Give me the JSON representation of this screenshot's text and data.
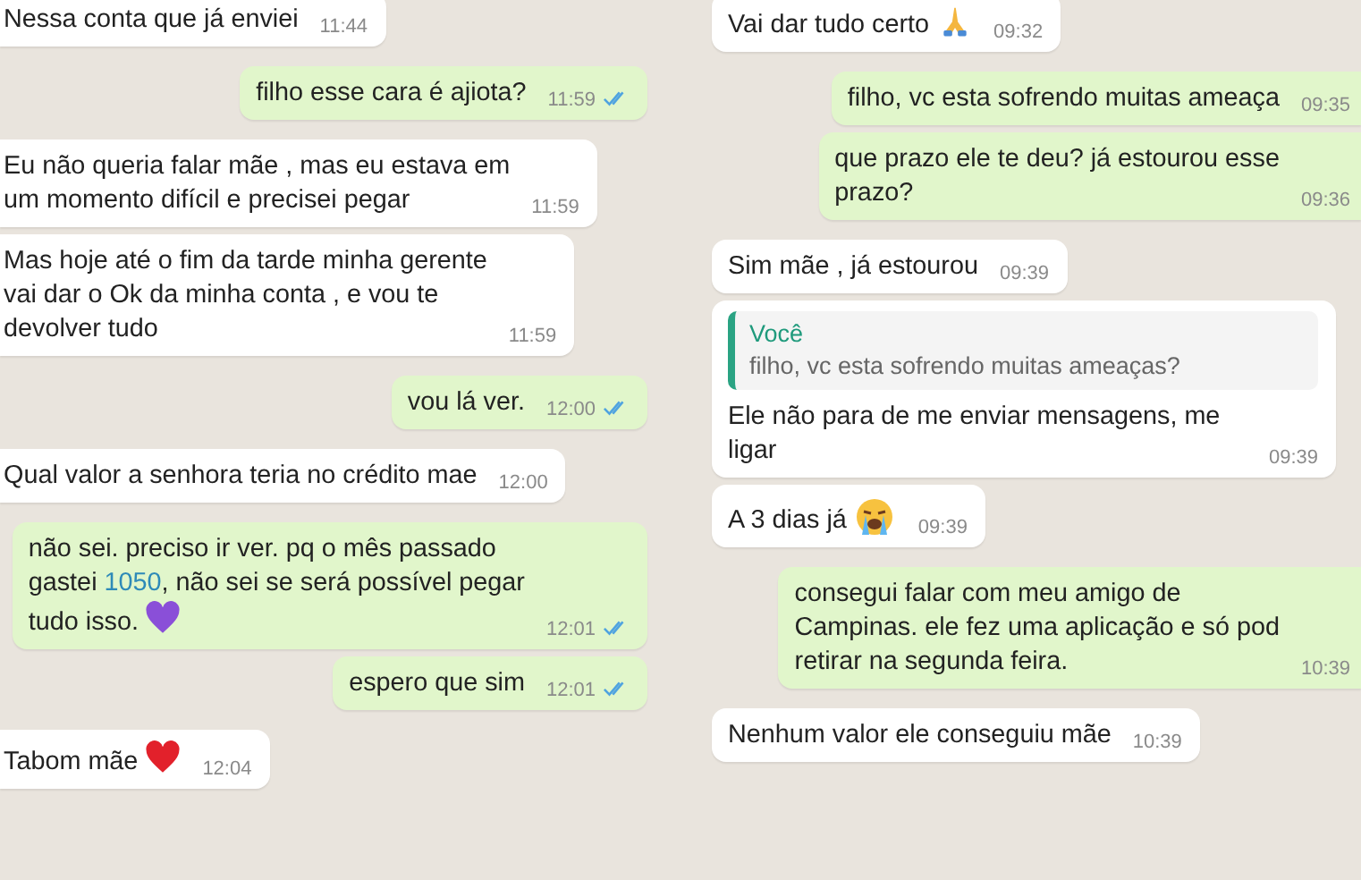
{
  "columns": [
    {
      "messages": [
        {
          "kind": "incoming",
          "segments": [
            {
              "kind": "plain",
              "text": "Nessa conta que já enviei"
            }
          ],
          "time": "11:44"
        },
        {
          "kind": "outgoing",
          "segments": [
            {
              "kind": "plain",
              "text": "filho esse cara é ajiota?"
            }
          ],
          "time": "11:59",
          "read": true
        },
        {
          "kind": "incoming",
          "segments": [
            {
              "kind": "plain",
              "text": "Eu não queria falar mãe , mas eu estava em"
            },
            {
              "kind": "break"
            },
            {
              "kind": "plain",
              "text": "um momento difícil e precisei pegar"
            }
          ],
          "time": "11:59"
        },
        {
          "kind": "incoming",
          "segments": [
            {
              "kind": "plain",
              "text": "Mas hoje até o fim da tarde minha gerente"
            },
            {
              "kind": "break"
            },
            {
              "kind": "plain",
              "text": "vai dar o Ok da minha conta , e vou te"
            },
            {
              "kind": "break"
            },
            {
              "kind": "plain",
              "text": "devolver tudo"
            }
          ],
          "time": "11:59"
        },
        {
          "kind": "outgoing",
          "segments": [
            {
              "kind": "plain",
              "text": "vou lá ver."
            }
          ],
          "time": "12:00",
          "read": true
        },
        {
          "kind": "incoming",
          "segments": [
            {
              "kind": "plain",
              "text": "Qual valor a senhora teria no crédito mae"
            },
            {
              "kind": "break"
            }
          ],
          "time": "12:00"
        },
        {
          "kind": "outgoing",
          "segments": [
            {
              "kind": "plain",
              "text": "não sei. preciso ir ver. pq o mês passado"
            },
            {
              "kind": "break"
            },
            {
              "kind": "plain",
              "text": "gastei "
            },
            {
              "kind": "link",
              "text": "1050"
            },
            {
              "kind": "plain",
              "text": ", não sei se será possível pegar"
            },
            {
              "kind": "break"
            },
            {
              "kind": "plain",
              "text": "tudo isso."
            }
          ],
          "emoji": {
            "kind": "heart",
            "color": "#8a4fd8"
          },
          "time": "12:01",
          "read": true
        },
        {
          "kind": "outgoing",
          "segments": [
            {
              "kind": "plain",
              "text": "espero que sim"
            }
          ],
          "time": "12:01",
          "read": true
        },
        {
          "kind": "incoming",
          "segments": [
            {
              "kind": "plain",
              "text": "Tabom mãe"
            }
          ],
          "emoji": {
            "kind": "heart",
            "color": "#e2212b"
          },
          "time": "12:04"
        }
      ]
    },
    {
      "messages": [
        {
          "kind": "incoming",
          "segments": [
            {
              "kind": "plain",
              "text": "Vai dar tudo certo"
            }
          ],
          "emoji": {
            "kind": "folded-hands"
          },
          "time": "09:32"
        },
        {
          "kind": "outgoing",
          "segments": [
            {
              "kind": "plain",
              "text": "filho, vc esta sofrendo muitas ameaça"
            },
            {
              "kind": "break"
            }
          ],
          "time": "09:35"
        },
        {
          "kind": "outgoing",
          "segments": [
            {
              "kind": "plain",
              "text": "que prazo ele te deu? já estourou esse"
            },
            {
              "kind": "break"
            },
            {
              "kind": "plain",
              "text": "prazo?"
            }
          ],
          "time": "09:36"
        },
        {
          "kind": "incoming",
          "segments": [
            {
              "kind": "plain",
              "text": "Sim mãe , já estourou"
            }
          ],
          "time": "09:39"
        },
        {
          "kind": "incoming",
          "quote": {
            "author": "Você",
            "text": "filho, vc esta sofrendo muitas ameaças?"
          },
          "segments": [
            {
              "kind": "plain",
              "text": "Ele não para de me enviar mensagens, me"
            },
            {
              "kind": "break"
            },
            {
              "kind": "plain",
              "text": "ligar"
            }
          ],
          "time": "09:39"
        },
        {
          "kind": "incoming",
          "segments": [
            {
              "kind": "plain",
              "text": "A 3 dias já"
            }
          ],
          "emoji": {
            "kind": "crying-face"
          },
          "time": "09:39"
        },
        {
          "kind": "outgoing",
          "segments": [
            {
              "kind": "plain",
              "text": "consegui falar com meu amigo de"
            },
            {
              "kind": "break"
            },
            {
              "kind": "plain",
              "text": "Campinas. ele fez uma aplicação e só pod"
            },
            {
              "kind": "break"
            },
            {
              "kind": "plain",
              "text": "retirar na segunda feira."
            }
          ],
          "time": "10:39"
        },
        {
          "kind": "incoming",
          "segments": [
            {
              "kind": "plain",
              "text": "Nenhum valor ele conseguiu mãe"
            }
          ],
          "time": "10:39"
        }
      ]
    }
  ]
}
